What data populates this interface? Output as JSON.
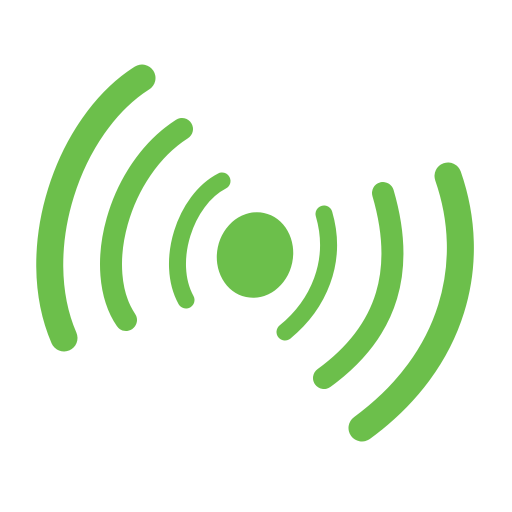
{
  "icon": {
    "name": "wireless-broadcast-icon",
    "color": "#6cbf4b",
    "background": "#ffffff"
  }
}
